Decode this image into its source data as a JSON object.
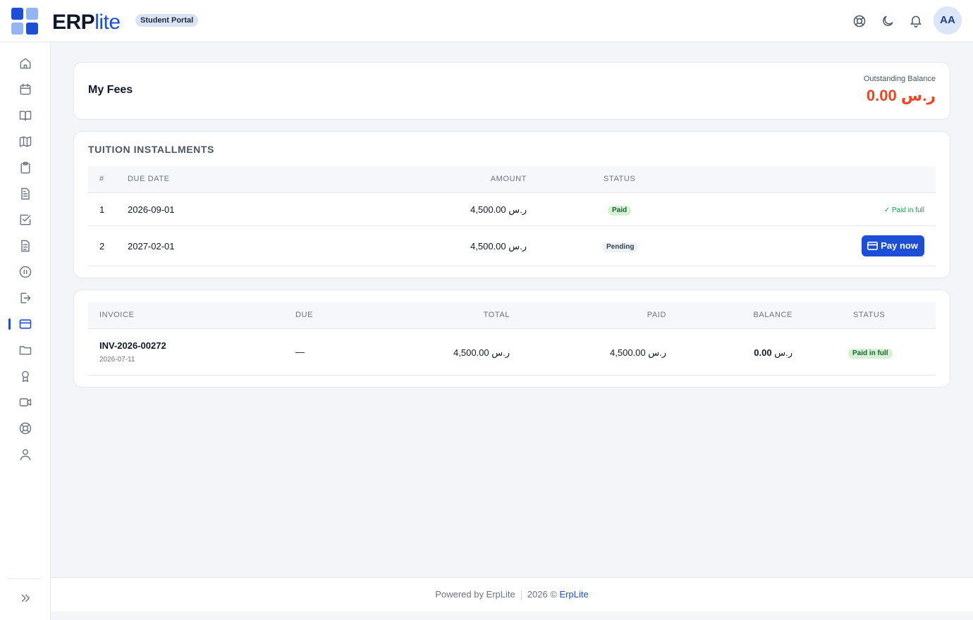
{
  "app": {
    "brand_erp": "ERP",
    "brand_lite": "lite",
    "portal_badge": "Student Portal",
    "avatar_initials": "AA"
  },
  "header_icons": [
    "help-lifebuoy-icon",
    "dark-mode-moon-icon",
    "notifications-bell-icon"
  ],
  "sidebar": {
    "items": [
      {
        "icon": "home-icon"
      },
      {
        "icon": "calendar-icon"
      },
      {
        "icon": "book-open-icon"
      },
      {
        "icon": "map-icon"
      },
      {
        "icon": "clipboard-icon"
      },
      {
        "icon": "document-icon"
      },
      {
        "icon": "checkbox-icon"
      },
      {
        "icon": "document-lines-icon"
      },
      {
        "icon": "pause-circle-icon"
      },
      {
        "icon": "logout-icon"
      },
      {
        "icon": "credit-card-icon",
        "active": true
      },
      {
        "icon": "folder-icon"
      },
      {
        "icon": "award-icon"
      },
      {
        "icon": "video-icon"
      },
      {
        "icon": "lifebuoy-icon"
      },
      {
        "icon": "user-icon"
      }
    ],
    "collapse_icon": "chevrons-right-icon"
  },
  "summary": {
    "title": "My Fees",
    "outstanding_label": "Outstanding Balance",
    "outstanding_value": "0.00 ر.س"
  },
  "installments": {
    "title": "TUITION INSTALLMENTS",
    "headers": {
      "num": "#",
      "due_date": "DUE DATE",
      "amount": "AMOUNT",
      "status": "STATUS"
    },
    "rows": [
      {
        "num": "1",
        "due_date": "2026-09-01",
        "amount": "4,500.00 ر.س",
        "status": "Paid",
        "action": "Paid in full"
      },
      {
        "num": "2",
        "due_date": "2027-02-01",
        "amount": "4,500.00 ر.س",
        "status": "Pending",
        "action": "Pay now"
      }
    ]
  },
  "invoices": {
    "headers": {
      "invoice": "INVOICE",
      "due": "DUE",
      "total": "TOTAL",
      "paid": "PAID",
      "balance": "BALANCE",
      "status": "STATUS"
    },
    "rows": [
      {
        "invoice": "INV-2026-00272",
        "date": "2026-07-11",
        "due": "—",
        "total": "4,500.00 ر.س",
        "paid": "4,500.00 ر.س",
        "balance_amount": "0.00",
        "balance_currency": "ر.س",
        "status": "Paid in full"
      }
    ]
  },
  "footer": {
    "powered_by": "Powered by ErpLite",
    "copyright": "2026 ©",
    "link": "ErpLite"
  },
  "colors": {
    "primary": "#1d4ed8",
    "danger": "#ef4423",
    "success": "#16a34a"
  }
}
